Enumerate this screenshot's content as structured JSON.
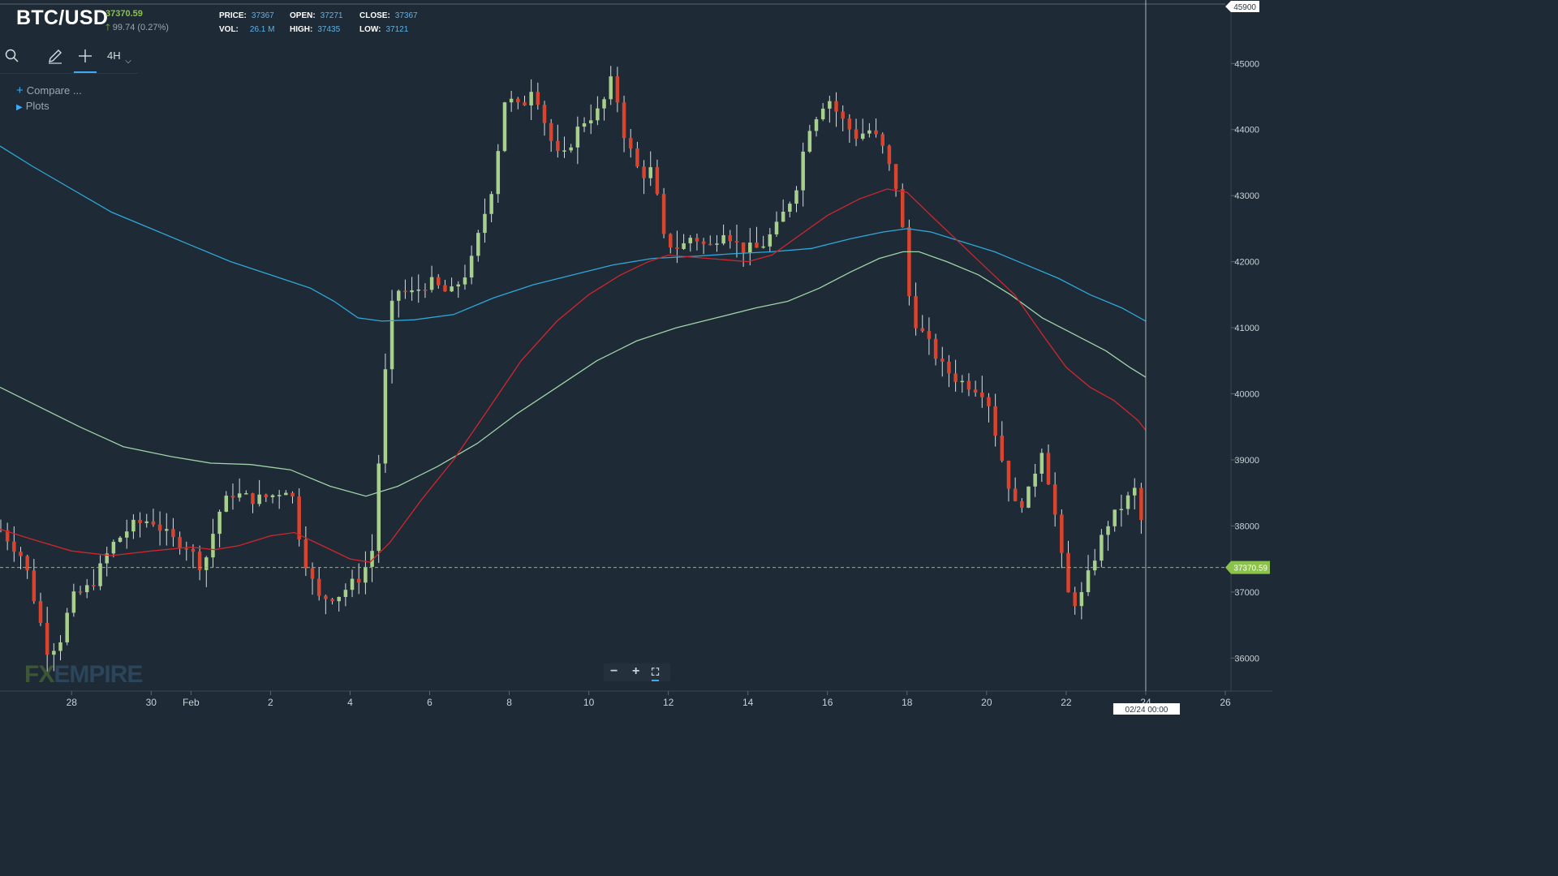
{
  "header": {
    "symbol": "BTC/USD",
    "last_price": "37370.59",
    "change": "99.74 (0.27%)",
    "price_label": "PRICE:",
    "price_value": "37367",
    "open_label": "OPEN:",
    "open_value": "37271",
    "close_label": "CLOSE:",
    "close_value": "37367",
    "vol_label": "VOL:",
    "vol_value": "26.1 M",
    "high_label": "HIGH:",
    "high_value": "37435",
    "low_label": "LOW:",
    "low_value": "37121"
  },
  "toolbar": {
    "search_icon": "search-icon",
    "draw_icon": "pencil-icon",
    "crosshair_icon": "crosshair-icon",
    "interval": "4H",
    "compare_label": "Compare ...",
    "plots_label": "Plots"
  },
  "zoom": {
    "minus": "−",
    "plus": "+",
    "fullscreen": "⛶"
  },
  "logo": {
    "fx": "FX",
    "rest": "EMPIRE"
  },
  "colors": {
    "background": "#1e2a35",
    "up_candle": "#a8d08d",
    "down_candle": "#d9442e",
    "ma_red": "#d0262e",
    "ma_green": "#9fd4a8",
    "ma_blue": "#2ea8d8",
    "axis_text": "#c9d1d9",
    "last_price_tag": "#8bc34a"
  },
  "chart_data": {
    "type": "candlestick",
    "interval": "4H",
    "ylim": [
      35500,
      45900
    ],
    "y_ticks": [
      36000,
      37000,
      38000,
      39000,
      40000,
      41000,
      42000,
      43000,
      44000,
      45000
    ],
    "y_top_label": "45900",
    "x_ticks": [
      {
        "label": "28",
        "day": 28
      },
      {
        "label": "30",
        "day": 30
      },
      {
        "label": "Feb",
        "day": 31
      },
      {
        "label": "2",
        "day": 33
      },
      {
        "label": "4",
        "day": 35
      },
      {
        "label": "6",
        "day": 37
      },
      {
        "label": "8",
        "day": 39
      },
      {
        "label": "10",
        "day": 41
      },
      {
        "label": "12",
        "day": 43
      },
      {
        "label": "14",
        "day": 45
      },
      {
        "label": "16",
        "day": 47
      },
      {
        "label": "18",
        "day": 49
      },
      {
        "label": "20",
        "day": 51
      },
      {
        "label": "22",
        "day": 53
      },
      {
        "label": "24",
        "day": 55
      },
      {
        "label": "26",
        "day": 57
      }
    ],
    "x_range_days": [
      26.2,
      57.0
    ],
    "cursor_day": 55,
    "cursor_date_label": "02/24 00:00",
    "last_price": 37370.59,
    "last_price_label": "37370.59",
    "anchors": [
      [
        26.2,
        37950
      ],
      [
        26.8,
        37500
      ],
      [
        27.4,
        36100
      ],
      [
        27.7,
        36250
      ],
      [
        28.0,
        36900
      ],
      [
        28.5,
        37100
      ],
      [
        29.0,
        37700
      ],
      [
        29.5,
        38000
      ],
      [
        30.0,
        38100
      ],
      [
        30.5,
        37800
      ],
      [
        30.9,
        37700
      ],
      [
        31.3,
        37350
      ],
      [
        31.7,
        38200
      ],
      [
        32.0,
        38500
      ],
      [
        32.6,
        38400
      ],
      [
        33.0,
        38450
      ],
      [
        33.5,
        38600
      ],
      [
        33.8,
        37600
      ],
      [
        34.2,
        36900
      ],
      [
        34.7,
        36950
      ],
      [
        35.0,
        37100
      ],
      [
        35.3,
        37250
      ],
      [
        35.6,
        37700
      ],
      [
        35.8,
        39800
      ],
      [
        36.1,
        41600
      ],
      [
        36.5,
        41500
      ],
      [
        37.0,
        41700
      ],
      [
        37.5,
        41500
      ],
      [
        38.0,
        41900
      ],
      [
        38.6,
        43200
      ],
      [
        38.9,
        44500
      ],
      [
        39.3,
        44300
      ],
      [
        39.6,
        44700
      ],
      [
        40.0,
        43900
      ],
      [
        40.3,
        43500
      ],
      [
        40.8,
        44100
      ],
      [
        41.3,
        44300
      ],
      [
        41.6,
        44800
      ],
      [
        41.9,
        43900
      ],
      [
        42.3,
        43300
      ],
      [
        42.6,
        43400
      ],
      [
        42.9,
        42300
      ],
      [
        43.3,
        42200
      ],
      [
        43.6,
        42400
      ],
      [
        44.0,
        42200
      ],
      [
        44.4,
        42500
      ],
      [
        44.8,
        42200
      ],
      [
        45.3,
        42200
      ],
      [
        45.7,
        42500
      ],
      [
        46.2,
        43100
      ],
      [
        46.5,
        44000
      ],
      [
        47.0,
        44500
      ],
      [
        47.3,
        44200
      ],
      [
        47.7,
        43900
      ],
      [
        48.1,
        44000
      ],
      [
        48.4,
        43700
      ],
      [
        48.8,
        43000
      ],
      [
        49.1,
        41200
      ],
      [
        49.5,
        40800
      ],
      [
        49.9,
        40400
      ],
      [
        50.3,
        40200
      ],
      [
        50.7,
        40100
      ],
      [
        51.0,
        40000
      ],
      [
        51.3,
        39200
      ],
      [
        51.7,
        38300
      ],
      [
        52.0,
        38400
      ],
      [
        52.4,
        39200
      ],
      [
        52.8,
        37900
      ],
      [
        53.0,
        37000
      ],
      [
        53.3,
        36800
      ],
      [
        53.7,
        37500
      ],
      [
        54.0,
        38000
      ],
      [
        54.4,
        38300
      ],
      [
        54.8,
        38600
      ],
      [
        55.0,
        37400
      ]
    ],
    "ma_red": [
      [
        26.2,
        37950
      ],
      [
        27.0,
        37800
      ],
      [
        28.0,
        37620
      ],
      [
        29.0,
        37550
      ],
      [
        30.0,
        37620
      ],
      [
        31.0,
        37680
      ],
      [
        31.6,
        37640
      ],
      [
        32.2,
        37700
      ],
      [
        33.0,
        37850
      ],
      [
        33.6,
        37900
      ],
      [
        34.2,
        37730
      ],
      [
        35.0,
        37500
      ],
      [
        35.5,
        37450
      ],
      [
        36.0,
        37750
      ],
      [
        36.8,
        38400
      ],
      [
        37.6,
        39000
      ],
      [
        38.4,
        39700
      ],
      [
        39.3,
        40500
      ],
      [
        40.2,
        41100
      ],
      [
        41.0,
        41500
      ],
      [
        41.8,
        41800
      ],
      [
        42.5,
        42000
      ],
      [
        43.0,
        42100
      ],
      [
        44.0,
        42050
      ],
      [
        45.0,
        42000
      ],
      [
        45.6,
        42100
      ],
      [
        46.3,
        42400
      ],
      [
        47.0,
        42700
      ],
      [
        47.8,
        42950
      ],
      [
        48.5,
        43100
      ],
      [
        49.0,
        43050
      ],
      [
        49.6,
        42700
      ],
      [
        50.3,
        42300
      ],
      [
        51.0,
        41900
      ],
      [
        51.7,
        41500
      ],
      [
        52.4,
        40900
      ],
      [
        53.0,
        40400
      ],
      [
        53.6,
        40100
      ],
      [
        54.2,
        39900
      ],
      [
        54.8,
        39600
      ],
      [
        55.0,
        39450
      ]
    ],
    "ma_green": [
      [
        26.2,
        40100
      ],
      [
        27.2,
        39800
      ],
      [
        28.2,
        39500
      ],
      [
        29.3,
        39200
      ],
      [
        30.5,
        39050
      ],
      [
        31.5,
        38950
      ],
      [
        32.5,
        38930
      ],
      [
        33.5,
        38850
      ],
      [
        34.5,
        38600
      ],
      [
        35.4,
        38450
      ],
      [
        36.2,
        38600
      ],
      [
        37.2,
        38900
      ],
      [
        38.2,
        39250
      ],
      [
        39.2,
        39700
      ],
      [
        40.2,
        40100
      ],
      [
        41.2,
        40500
      ],
      [
        42.2,
        40800
      ],
      [
        43.2,
        41000
      ],
      [
        44.2,
        41150
      ],
      [
        45.2,
        41300
      ],
      [
        46.0,
        41400
      ],
      [
        46.8,
        41600
      ],
      [
        47.6,
        41850
      ],
      [
        48.3,
        42050
      ],
      [
        48.9,
        42150
      ],
      [
        49.3,
        42150
      ],
      [
        50.0,
        42000
      ],
      [
        50.8,
        41800
      ],
      [
        51.6,
        41500
      ],
      [
        52.4,
        41150
      ],
      [
        53.2,
        40900
      ],
      [
        54.0,
        40650
      ],
      [
        54.6,
        40400
      ],
      [
        55.0,
        40250
      ]
    ],
    "ma_blue": [
      [
        26.2,
        43750
      ],
      [
        27.0,
        43450
      ],
      [
        28.0,
        43100
      ],
      [
        29.0,
        42750
      ],
      [
        30.0,
        42500
      ],
      [
        31.0,
        42250
      ],
      [
        32.0,
        42000
      ],
      [
        33.0,
        41800
      ],
      [
        34.0,
        41600
      ],
      [
        34.6,
        41400
      ],
      [
        35.2,
        41150
      ],
      [
        35.8,
        41100
      ],
      [
        36.6,
        41120
      ],
      [
        37.6,
        41200
      ],
      [
        38.6,
        41450
      ],
      [
        39.6,
        41650
      ],
      [
        40.6,
        41800
      ],
      [
        41.6,
        41950
      ],
      [
        42.6,
        42050
      ],
      [
        43.6,
        42080
      ],
      [
        44.6,
        42120
      ],
      [
        45.6,
        42150
      ],
      [
        46.6,
        42200
      ],
      [
        47.6,
        42350
      ],
      [
        48.4,
        42450
      ],
      [
        49.0,
        42500
      ],
      [
        49.6,
        42450
      ],
      [
        50.4,
        42300
      ],
      [
        51.2,
        42150
      ],
      [
        52.0,
        41950
      ],
      [
        52.8,
        41750
      ],
      [
        53.6,
        41500
      ],
      [
        54.4,
        41300
      ],
      [
        55.0,
        41100
      ]
    ]
  }
}
